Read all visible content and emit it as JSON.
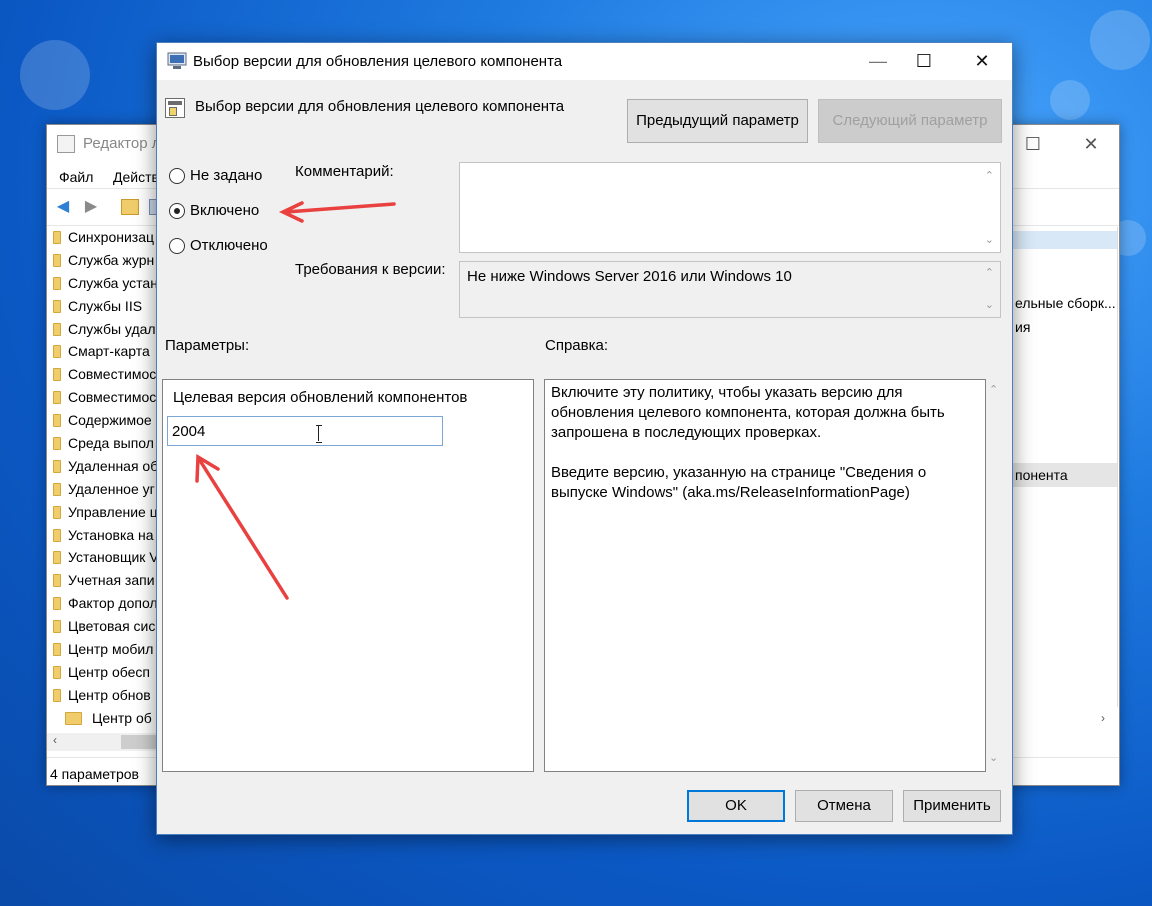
{
  "background_window": {
    "title": "Редактор л",
    "menu": [
      "Файл",
      "Действ"
    ],
    "tree_items": [
      "Синхронизац",
      "Служба журн",
      "Служба устан",
      "Службы IIS",
      "Службы удал",
      "Смарт-карта",
      "Совместимос",
      "Совместимос",
      "Содержимое",
      "Среда выпол",
      "Удаленная об",
      "Удаленное уг",
      "Управление ц",
      "Установка на",
      "Установщик V",
      "Учетная запи",
      "Фактор допол",
      "Цветовая сис",
      "Центр мобил",
      "Центр обесп",
      "Центр обнов"
    ],
    "selected_item": "Центр об",
    "status": "4 параметров",
    "right_items": [
      "ельные сборк...",
      "ия",
      "понента"
    ]
  },
  "dialog": {
    "title": "Выбор версии для обновления целевого компонента",
    "header_title": "Выбор версии для обновления целевого компонента",
    "prev_button": "Предыдущий параметр",
    "next_button": "Следующий параметр",
    "radios": {
      "not_configured": "Не задано",
      "enabled": "Включено",
      "disabled": "Отключено",
      "selected": "enabled"
    },
    "comment_label": "Комментарий:",
    "comment_value": "",
    "requirements_label": "Требования к версии:",
    "requirements_value": "Не ниже Windows Server 2016 или Windows 10",
    "options_label": "Параметры:",
    "help_label": "Справка:",
    "option_field_label": "Целевая версия обновлений компонентов",
    "option_field_value": "2004",
    "help_paragraphs": [
      "Включите эту политику, чтобы указать версию для обновления целевого компонента, которая должна быть запрошена в последующих проверках.",
      "Введите версию, указанную на странице \"Сведения о выпуске Windows\" (aka.ms/ReleaseInformationPage)"
    ],
    "ok_button": "OK",
    "cancel_button": "Отмена",
    "apply_button": "Применить"
  },
  "colors": {
    "annotation_arrow": "#e8413f",
    "desktop": "#1f7be0",
    "accent": "#0078d7"
  }
}
